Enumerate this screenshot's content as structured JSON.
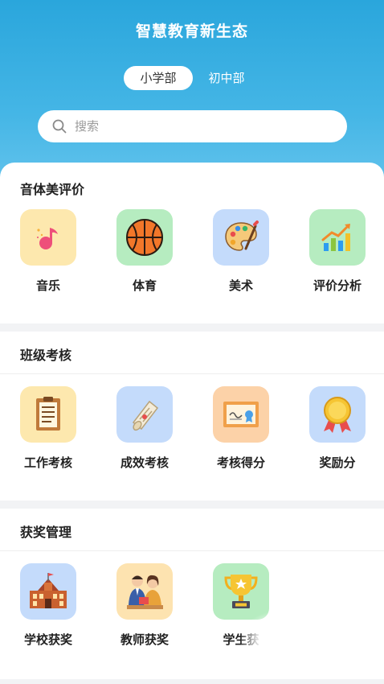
{
  "header": {
    "title": "智慧教育新生态",
    "tabs": [
      {
        "label": "小学部",
        "active": true
      },
      {
        "label": "初中部",
        "active": false
      }
    ]
  },
  "search": {
    "placeholder": "搜索",
    "icon": "search-icon"
  },
  "sections": [
    {
      "title": "音体美评价",
      "items": [
        {
          "label": "音乐",
          "icon": "music-note-icon"
        },
        {
          "label": "体育",
          "icon": "basketball-icon"
        },
        {
          "label": "美术",
          "icon": "palette-icon"
        },
        {
          "label": "评价分析",
          "icon": "bar-chart-icon"
        }
      ]
    },
    {
      "title": "班级考核",
      "items": [
        {
          "label": "工作考核",
          "icon": "clipboard-icon"
        },
        {
          "label": "成效考核",
          "icon": "scroll-icon"
        },
        {
          "label": "考核得分",
          "icon": "certificate-icon"
        },
        {
          "label": "奖励分",
          "icon": "medal-icon"
        }
      ]
    },
    {
      "title": "获奖管理",
      "items": [
        {
          "label": "学校获奖",
          "icon": "school-building-icon"
        },
        {
          "label": "教师获奖",
          "icon": "teachers-icon"
        },
        {
          "label": "学生获",
          "icon": "trophy-icon"
        }
      ]
    }
  ],
  "colors": {
    "header_gradient_top": "#2aa6dc",
    "header_gradient_bottom": "#6cc7ee",
    "icon_bg_yellow": "#fde8ae",
    "icon_bg_green": "#b6ecc0",
    "icon_bg_blue": "#c4dbfb",
    "icon_bg_orange": "#fcd2a8"
  }
}
